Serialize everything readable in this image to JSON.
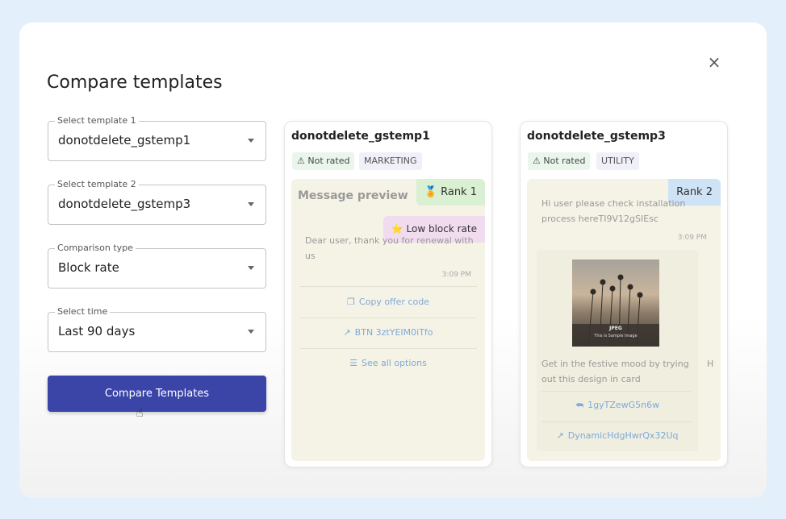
{
  "dialog": {
    "title": "Compare templates",
    "close_icon": "×"
  },
  "form": {
    "template1": {
      "label": "Select template 1",
      "value": "donotdelete_gstemp1"
    },
    "template2": {
      "label": "Select template 2",
      "value": "donotdelete_gstemp3"
    },
    "comparison": {
      "label": "Comparison type",
      "value": "Block rate"
    },
    "time": {
      "label": "Select time",
      "value": "Last 90 days"
    },
    "compare_button": "Compare Templates"
  },
  "card1": {
    "name": "donotdelete_gstemp1",
    "rating_icon": "⚠",
    "rating": "Not rated",
    "category": "MARKETING",
    "preview_title": "Message preview",
    "rank_icon": "🏅",
    "rank": "Rank 1",
    "badge_icon": "⭐",
    "badge": "Low block rate",
    "message": "Dear user, thank you for renewal with us",
    "time": "3:09 PM",
    "actions": [
      {
        "icon": "❐",
        "label": "Copy offer code"
      },
      {
        "icon": "↗",
        "label": "BTN 3ztYEIM0iTfo"
      },
      {
        "icon": "☰",
        "label": "See all options"
      }
    ]
  },
  "card2": {
    "name": "donotdelete_gstemp3",
    "rating_icon": "⚠",
    "rating": "Not rated",
    "category": "UTILITY",
    "rank": "Rank 2",
    "message": "Hi user please check installation process hereTI9V12gSIEsc",
    "time1": "3:09 PM",
    "image_label": "JPEG",
    "image_caption": "This is Sample Image",
    "message2": "Get in the festive mood by trying out this design in card",
    "side_letter": "H",
    "actions": [
      {
        "icon": "⮪",
        "label": "1gyTZewG5n6w"
      },
      {
        "icon": "↗",
        "label": "DynamicHdgHwrQx32Uq"
      }
    ]
  },
  "colors": {
    "primary_button": "#3b45a8",
    "rank1_bg": "#d9f0d2",
    "badge_bg": "#f1dcef",
    "rank2_bg": "#cfe3f6"
  }
}
